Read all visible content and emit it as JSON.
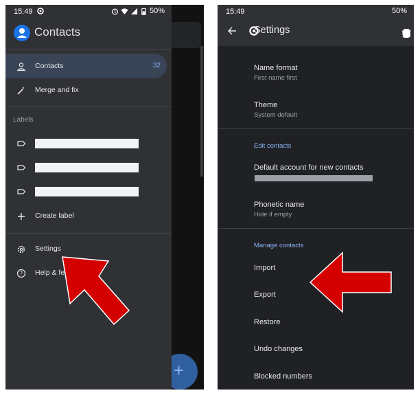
{
  "left": {
    "status": {
      "time": "15:49",
      "battery": "50%"
    },
    "app_title": "Contacts",
    "nav": [
      {
        "label": "Contacts",
        "count": "32",
        "icon": "person-icon"
      },
      {
        "label": "Merge and fix",
        "icon": "wand-icon"
      }
    ],
    "labels_heading": "Labels",
    "create_label": "Create label",
    "settings": "Settings",
    "help": "Help & fe"
  },
  "right": {
    "status": {
      "time": "15:49",
      "battery": "50%"
    },
    "title": "Settings",
    "items": [
      {
        "title": "Name format",
        "subtitle": "First name first"
      },
      {
        "title": "Theme",
        "subtitle": "System default"
      }
    ],
    "edit_heading": "Edit contacts",
    "default_account": "Default account for new contacts",
    "phonetic": {
      "title": "Phonetic name",
      "subtitle": "Hide if empty"
    },
    "manage_heading": "Manage contacts",
    "manage_items": [
      "Import",
      "Export",
      "Restore",
      "Undo changes",
      "Blocked numbers"
    ]
  },
  "colors": {
    "accent": "#8ab4f8",
    "arrow": "#d40000",
    "drawer": "#303134",
    "surface": "#202124"
  }
}
